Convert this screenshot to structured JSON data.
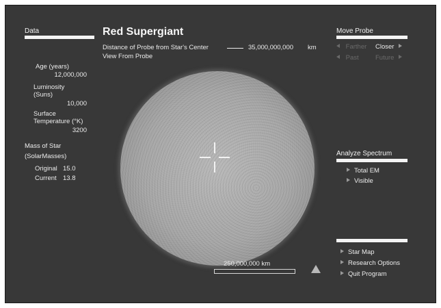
{
  "data_panel": {
    "header": "Data",
    "age_label": "Age (years)",
    "age_value": "12,000,000",
    "luminosity_label_1": "Luminosity",
    "luminosity_label_2": "(Suns)",
    "luminosity_value": "10,000",
    "temp_label_1": "Surface",
    "temp_label_2": "Temperature (°K)",
    "temp_value": "3200",
    "mass_label_1": "Mass of Star",
    "mass_label_2": "(SolarMasses)",
    "original_label": "Original",
    "original_value": "15.0",
    "current_label": "Current",
    "current_value": "13.8"
  },
  "main": {
    "title": "Red Supergiant",
    "distance_label": "Distance of Probe from Star's Center",
    "distance_value": "35,000,000,000",
    "distance_unit": "km",
    "view_label": "View From Probe",
    "scale_label": "250,000,000 km"
  },
  "move_probe": {
    "header": "Move Probe",
    "farther": "Farther",
    "closer": "Closer",
    "past": "Past",
    "future": "Future"
  },
  "analyze": {
    "header": "Analyze Spectrum",
    "total_em": "Total EM",
    "visible": "Visible"
  },
  "nav": {
    "star_map": "Star Map",
    "research_options": "Research Options",
    "quit_program": "Quit Program"
  },
  "colors": {
    "background": "#383838",
    "text": "#ececec",
    "disabled": "#6a6a6a",
    "star": "#a6a6a6"
  }
}
